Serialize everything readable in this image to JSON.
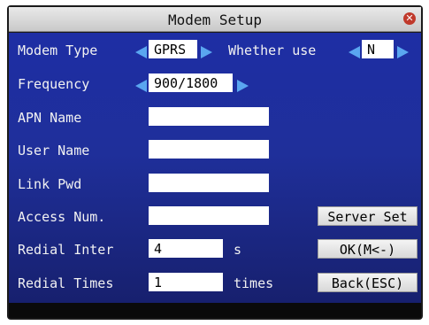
{
  "window": {
    "title": "Modem Setup"
  },
  "icons": {
    "close": "close-icon"
  },
  "form": {
    "modem_type": {
      "label": "Modem Type",
      "value": "GPRS"
    },
    "whether_use": {
      "label": "Whether use",
      "value": "N"
    },
    "frequency": {
      "label": "Frequency",
      "value": "900/1800"
    },
    "apn_name": {
      "label": "APN Name",
      "value": ""
    },
    "user_name": {
      "label": "User Name",
      "value": ""
    },
    "link_pwd": {
      "label": "Link Pwd",
      "value": ""
    },
    "access_num": {
      "label": "Access Num.",
      "value": ""
    },
    "redial_inter": {
      "label": "Redial Inter",
      "value": "4",
      "unit": "s"
    },
    "redial_times": {
      "label": "Redial Times",
      "value": "1",
      "unit": "times"
    }
  },
  "buttons": {
    "server_set": "Server Set",
    "ok": "OK(M<-)",
    "back": "Back(ESC)"
  },
  "colors": {
    "panel": "#1e2ea4",
    "arrow": "#5aa6f0",
    "close": "#c0392b"
  }
}
